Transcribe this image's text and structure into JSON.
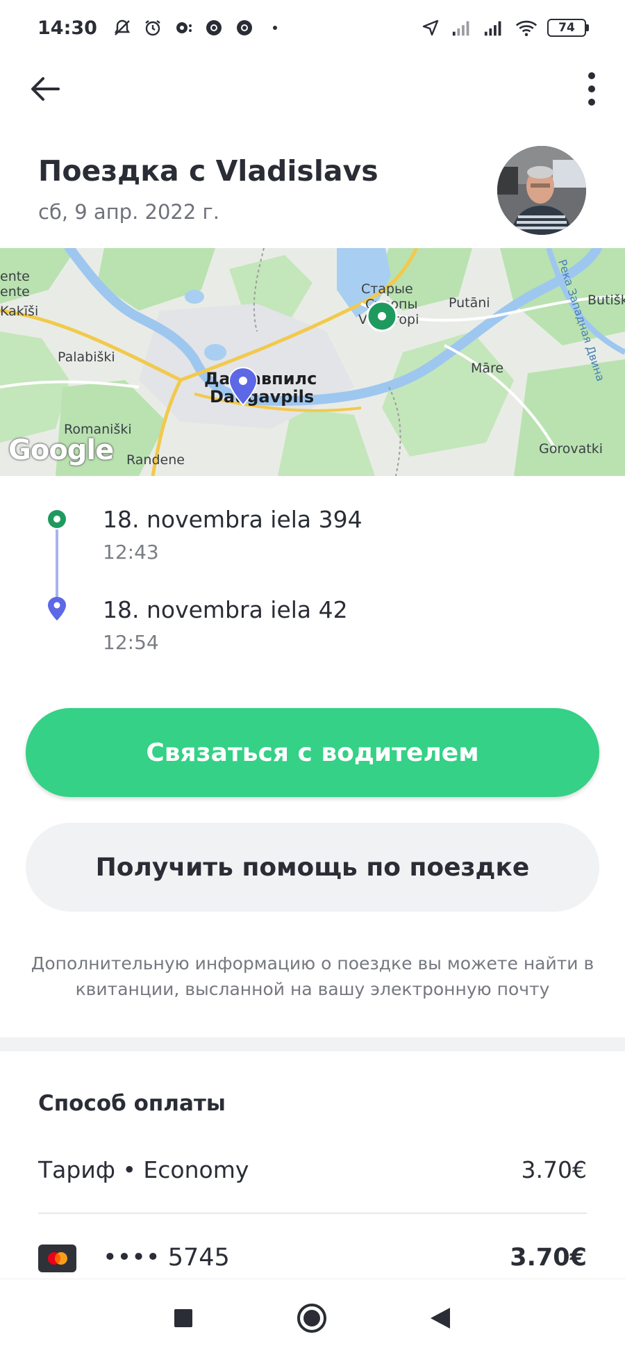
{
  "status_bar": {
    "time": "14:30",
    "battery": "74",
    "icons": [
      "mute-icon",
      "alarm-icon",
      "notification-icon",
      "chrome-icon",
      "chrome-icon",
      "dot-icon",
      "location-icon",
      "signal-icon",
      "signal-icon",
      "wifi-icon"
    ]
  },
  "header": {
    "title": "Поездка с Vladislavs",
    "date": "сб, 9 апр. 2022 г."
  },
  "map": {
    "labels": {
      "ente1": "ente",
      "ente2": "ente",
      "kakisi": "Kakīši",
      "palabiski": "Palabiški",
      "romaniski": "Romaniški",
      "randene": "Randene",
      "daugavpils_ru": "Даугавпилс",
      "daugavpils_lv": "Daugavpils",
      "starye": "Старые",
      "stropy": "Стропы",
      "vecstropi": "Vecstropi",
      "putani": "Putāni",
      "mare": "Māre",
      "gorovatki": "Gorovatki",
      "butiski": "Butišk",
      "river": "Река Западная Двина"
    },
    "attribution": "Google"
  },
  "route": {
    "start": {
      "address": "18. novembra iela 394",
      "time": "12:43"
    },
    "end": {
      "address": "18. novembra iela 42",
      "time": "12:54"
    }
  },
  "actions": {
    "contact_label": "Связаться с водителем",
    "help_label": "Получить помощь по поездке"
  },
  "info_note": "Дополнительную информацию о поездке вы можете найти в квитанции, высланной на вашу электронную почту",
  "payment": {
    "title": "Способ оплаты",
    "tariff_label": "Тариф • Economy",
    "tariff_price": "3.70€",
    "card_number": "•••• 5745",
    "card_amount": "3.70€"
  },
  "colors": {
    "accent_green": "#34d186",
    "start_marker": "#1f9a5f",
    "end_marker": "#5c68e6",
    "text": "#2a2d35"
  }
}
